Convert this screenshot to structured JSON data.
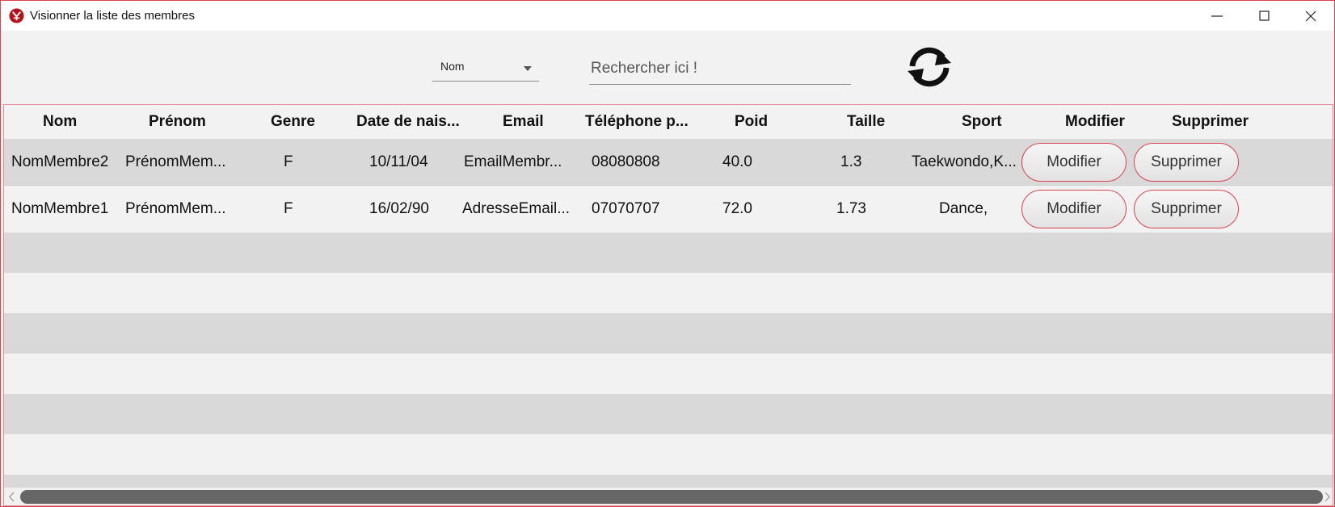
{
  "window": {
    "title": "Visionner la liste des membres",
    "accent_color": "#d9424f"
  },
  "toolbar": {
    "filter_select": {
      "selected": "Nom"
    },
    "search": {
      "placeholder": "Rechercher ici !",
      "value": ""
    },
    "refresh_icon": "refresh-icon"
  },
  "table": {
    "columns": [
      "Nom",
      "Prénom",
      "Genre",
      "Date de nais...",
      "Email",
      "Téléphone p...",
      "Poid",
      "Taille",
      "Sport",
      "Modifier",
      "Supprimer"
    ],
    "rows": [
      {
        "nom": "NomMembre2",
        "prenom": "PrénomMem...",
        "genre": "F",
        "date": "10/11/04",
        "email": "EmailMembr...",
        "telephone": "08080808",
        "poid": "40.0",
        "taille": "1.3",
        "sport": "Taekwondo,K...",
        "modifier": "Modifier",
        "supprimer": "Supprimer"
      },
      {
        "nom": "NomMembre1",
        "prenom": "PrénomMem...",
        "genre": "F",
        "date": "16/02/90",
        "email": "AdresseEmail...",
        "telephone": "07070707",
        "poid": "72.0",
        "taille": "1.73",
        "sport": "Dance,",
        "modifier": "Modifier",
        "supprimer": "Supprimer"
      }
    ]
  }
}
